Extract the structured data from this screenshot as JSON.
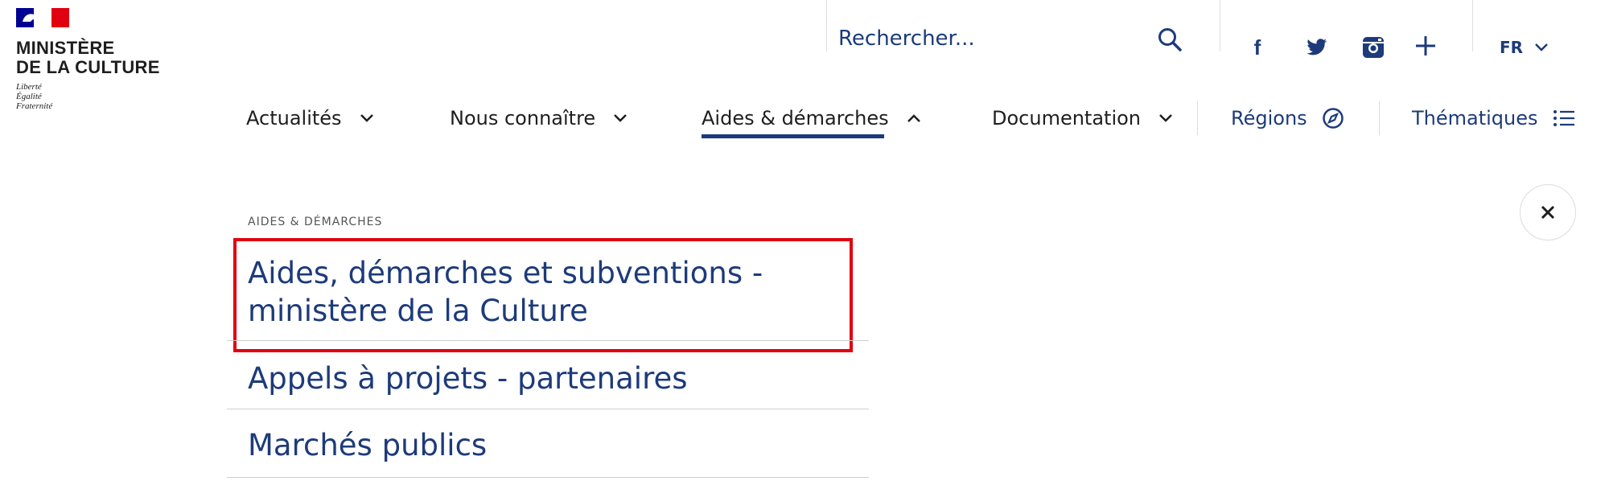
{
  "logo": {
    "title_line1": "MINISTÈRE",
    "title_line2": "DE LA CULTURE",
    "motto_1": "Liberté",
    "motto_2": "Égalité",
    "motto_3": "Fraternité"
  },
  "search": {
    "placeholder": "Rechercher...",
    "icon": "search-icon"
  },
  "social": {
    "facebook_letter": "f",
    "icons": [
      "facebook-icon",
      "twitter-icon",
      "instagram-icon",
      "plus-icon"
    ]
  },
  "language": {
    "selected": "FR",
    "icon": "chevron-down-icon"
  },
  "nav": {
    "items": [
      {
        "label": "Actualités",
        "icon": "chevron-down-icon"
      },
      {
        "label": "Nous connaître",
        "icon": "chevron-down-icon"
      },
      {
        "label": "Aides & démarches",
        "icon": "chevron-up-icon",
        "active": true
      },
      {
        "label": "Documentation",
        "icon": "chevron-down-icon"
      },
      {
        "label": "Régions",
        "icon": "compass-icon"
      },
      {
        "label": "Thématiques",
        "icon": "list-icon"
      }
    ]
  },
  "dropdown": {
    "section_label": "AIDES & DÉMARCHES",
    "links": [
      {
        "label_line1": "Aides, démarches et subventions -",
        "label_line2": "ministère de la Culture"
      },
      {
        "label": "Appels à projets - partenaires"
      },
      {
        "label": "Marchés publics"
      }
    ],
    "close_icon": "close-icon"
  },
  "colors": {
    "brand_blue": "#000091",
    "brand_red": "#e1000f",
    "link_blue": "#1d3b7a",
    "highlight_red": "#e1000f",
    "text_dark": "#1e1e1e"
  }
}
